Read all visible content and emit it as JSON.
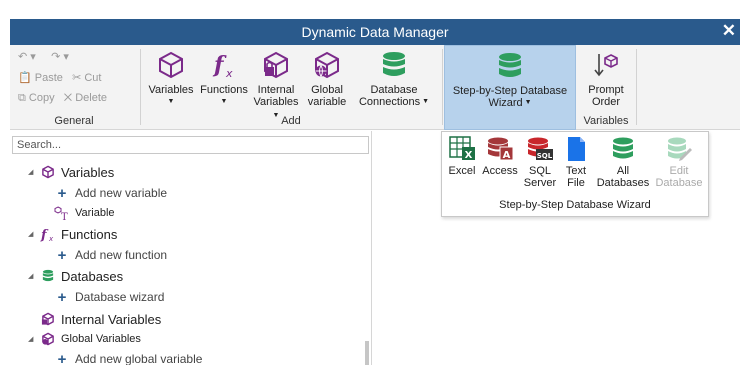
{
  "window": {
    "title": "Dynamic Data Manager",
    "close_glyph": "✕"
  },
  "ribbon": {
    "general": {
      "label": "General",
      "paste": "Paste",
      "cut": "Cut",
      "copy": "Copy",
      "delete": "Delete"
    },
    "add": {
      "label": "Add",
      "variables": "Variables",
      "functions": "Functions",
      "internal_1": "Internal",
      "internal_2": "Variables",
      "global_1": "Global",
      "global_2": "variable",
      "database_1": "Database",
      "database_2": "Connections"
    },
    "wizard": {
      "line1": "Step-by-Step Database",
      "line2": "Wizard"
    },
    "prompt": {
      "line1": "Prompt",
      "line2": "Order",
      "group_label": "Variables"
    }
  },
  "dropdown": {
    "caption": "Step-by-Step Database Wizard",
    "items": [
      {
        "line1": "Excel",
        "line2": ""
      },
      {
        "line1": "Access",
        "line2": ""
      },
      {
        "line1": "SQL",
        "line2": "Server"
      },
      {
        "line1": "Text",
        "line2": "File"
      },
      {
        "line1": "All",
        "line2": "Databases"
      },
      {
        "line1": "Edit",
        "line2": "Database"
      }
    ]
  },
  "search": {
    "placeholder": "Search..."
  },
  "tree": {
    "variables": "Variables",
    "add_variable": "Add new variable",
    "variable": "Variable",
    "functions": "Functions",
    "add_function": "Add new function",
    "databases": "Databases",
    "database_wizard": "Database wizard",
    "internal_variables": "Internal Variables",
    "global_variables": "Global Variables",
    "add_global": "Add new global variable"
  },
  "colors": {
    "titlebar": "#2a5a8c",
    "purple_icon": "#7b2a8a",
    "green_db": "#2e9e5e",
    "blue_plus": "#2a5a8c",
    "wizard_highlight": "#b7d2ec"
  }
}
